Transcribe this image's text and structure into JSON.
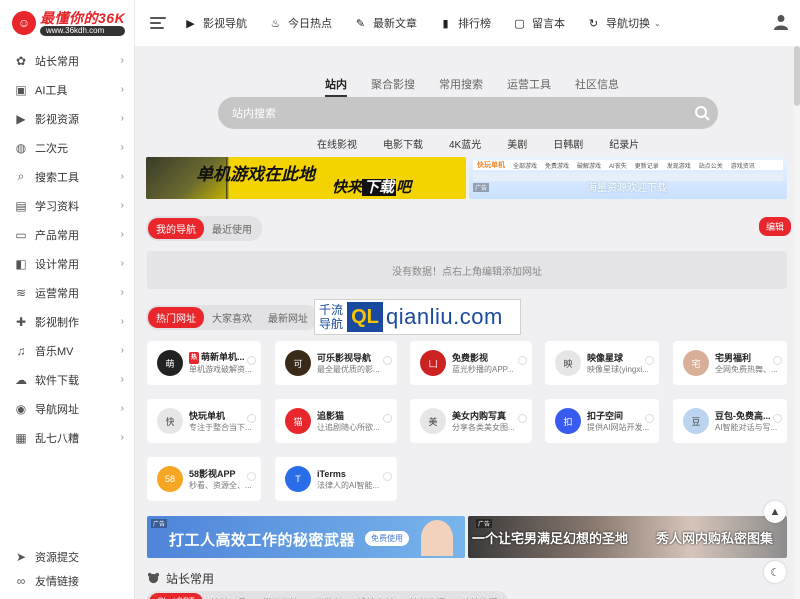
{
  "logo": {
    "title": "最懂你的36K",
    "subtitle": "www.36kdh.com"
  },
  "sidebar": {
    "items": [
      {
        "label": "站长常用",
        "icon": "webmaster-icon"
      },
      {
        "label": "AI工具",
        "icon": "toolbox-icon"
      },
      {
        "label": "影视资源",
        "icon": "video-icon"
      },
      {
        "label": "二次元",
        "icon": "anime-icon"
      },
      {
        "label": "搜索工具",
        "icon": "search-icon"
      },
      {
        "label": "学习资料",
        "icon": "book-icon"
      },
      {
        "label": "产品常用",
        "icon": "laptop-icon"
      },
      {
        "label": "设计常用",
        "icon": "design-icon"
      },
      {
        "label": "运营常用",
        "icon": "layers-icon"
      },
      {
        "label": "影视制作",
        "icon": "gamepad-icon"
      },
      {
        "label": "音乐MV",
        "icon": "music-icon"
      },
      {
        "label": "软件下载",
        "icon": "cloud-download-icon"
      },
      {
        "label": "导航网址",
        "icon": "globe-icon"
      },
      {
        "label": "乱七八糟",
        "icon": "grid-icon"
      }
    ],
    "bottom": [
      {
        "label": "资源提交",
        "icon": "send-icon"
      },
      {
        "label": "友情链接",
        "icon": "link-icon"
      }
    ]
  },
  "topbar": {
    "links": [
      {
        "label": "影视导航",
        "icon": "play-circle-icon"
      },
      {
        "label": "今日热点",
        "icon": "flame-icon"
      },
      {
        "label": "最新文章",
        "icon": "edit-icon"
      },
      {
        "label": "排行榜",
        "icon": "bar-chart-icon"
      },
      {
        "label": "留言本",
        "icon": "message-icon"
      },
      {
        "label": "导航切换",
        "icon": "refresh-icon"
      }
    ]
  },
  "search": {
    "tabs": [
      "站内",
      "聚合影搜",
      "常用搜索",
      "运营工具",
      "社区信息"
    ],
    "placeholder": "站内搜索",
    "quick_links": [
      "在线影视",
      "电影下载",
      "4K蓝光",
      "美剧",
      "日韩剧",
      "纪录片"
    ]
  },
  "banners": {
    "a_line1": "单机游戏在此地",
    "a_line2_pre": "快来",
    "a_line2_hl": "下载",
    "a_line2_post": "吧",
    "b_logo": "快玩单机",
    "b_menu": [
      "全部游戏",
      "免费游戏",
      "破解游戏",
      "AI丧失",
      "更新记录",
      "发现游戏",
      "站点公关",
      "游戏资讯"
    ],
    "b_welcome": "海量资源欢迎下载",
    "b_tag": "广告",
    "c_tag": "广告",
    "c_text": "打工人高效工作的秘密武器",
    "c_free": "免费使用",
    "d_tag": "广告",
    "d_text1": "一个让宅男满足幻想的圣地",
    "d_text2": "秀人网内购私密图集"
  },
  "my_nav": {
    "tabs": [
      "我的导航",
      "最近使用"
    ],
    "edit": "编辑",
    "empty": "没有数据！点右上角编辑添加网址"
  },
  "hot": {
    "tabs": [
      "热门网址",
      "大家喜欢",
      "最新网址"
    ],
    "ql_cn": "千流导航",
    "ql_logo": "QL",
    "ql_url": "qianliu.com",
    "hot_badge": "热"
  },
  "cards": [
    {
      "title": "萌新单机...",
      "desc": "单机游戏破解资...",
      "color": "#222222",
      "icon_text": "萌",
      "hot": true
    },
    {
      "title": "可乐影视导航",
      "desc": "最全最优质的影...",
      "color": "#3a2a1a",
      "icon_text": "可"
    },
    {
      "title": "免费影视",
      "desc": "蓝光秒播的APP...",
      "color": "#cc2222",
      "icon_text": "凵"
    },
    {
      "title": "映像星球",
      "desc": "映像星球(yingxi...",
      "color": "#e6e6e6",
      "icon_text": "映"
    },
    {
      "title": "宅男福利",
      "desc": "全网免费热舞、...",
      "color": "#d8b09a",
      "icon_text": "宅"
    },
    {
      "title": "快玩单机",
      "desc": "专注于整合当下...",
      "color": "#e6e6e6",
      "icon_text": "快"
    },
    {
      "title": "追影猫",
      "desc": "让追剧随心所欲...",
      "color": "#e8262b",
      "icon_text": "猫"
    },
    {
      "title": "美女内购写真",
      "desc": "分享各类美女图...",
      "color": "#e6e6e6",
      "icon_text": "美"
    },
    {
      "title": "扣子空间",
      "desc": "提供AI网站开发...",
      "color": "#3a5bf0",
      "icon_text": "扣"
    },
    {
      "title": "豆包-免费高...",
      "desc": "AI智能对话与写...",
      "color": "#bcd4f0",
      "icon_text": "豆"
    },
    {
      "title": "58影视APP",
      "desc": "秒看、资源全、...",
      "color": "#f5a623",
      "icon_text": "58"
    },
    {
      "title": "iTerms",
      "desc": "法律人的AI智能...",
      "color": "#2a6de8",
      "icon_text": "T"
    }
  ],
  "section": {
    "title": "站长常用",
    "tabs": [
      "ChatGPT",
      "站长工具",
      "常用网址",
      "开发者",
      "设计素材",
      "站长资讯",
      "建站资源"
    ]
  }
}
